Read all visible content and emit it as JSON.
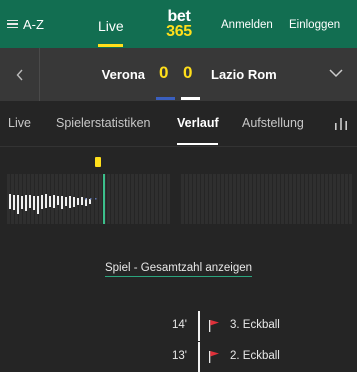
{
  "header": {
    "menu_label": "A-Z",
    "live_label": "Live",
    "logo_top": "bet",
    "logo_bottom": "365",
    "login_label": "Anmelden",
    "register_label": "Einloggen",
    "colors": {
      "brand": "#126e51",
      "accent": "#ffdf1b"
    }
  },
  "match": {
    "home_team": "Verona",
    "home_score": "0",
    "away_score": "0",
    "away_team": "Lazio Rom",
    "home_color": "#3a5fbf",
    "away_color": "#ffffff"
  },
  "tabs": [
    {
      "label": "Live",
      "active": false
    },
    {
      "label": "Spielerstatistiken",
      "active": false
    },
    {
      "label": "Verlauf",
      "active": true
    },
    {
      "label": "Aufstellung",
      "active": false
    }
  ],
  "timeline": {
    "home_bars": [
      5,
      4,
      4,
      3,
      4,
      4,
      3,
      3,
      4,
      5,
      3,
      4,
      3,
      3,
      2,
      3,
      2,
      1,
      2,
      1
    ],
    "away_bars": [
      10,
      11,
      15,
      10,
      12,
      9,
      11,
      15,
      10,
      9,
      8,
      9,
      6,
      10,
      7,
      9,
      8,
      6,
      6,
      7,
      5
    ],
    "event_marker_color": "#ffdf1b",
    "current_marker_color": "#3cbf8b"
  },
  "show_total_label": "Spiel - Gesamtzahl anzeigen",
  "events": [
    {
      "minute": "14'",
      "label": "3. Eckball",
      "icon": "corner-flag-icon"
    },
    {
      "minute": "13'",
      "label": "2. Eckball",
      "icon": "corner-flag-icon"
    }
  ]
}
